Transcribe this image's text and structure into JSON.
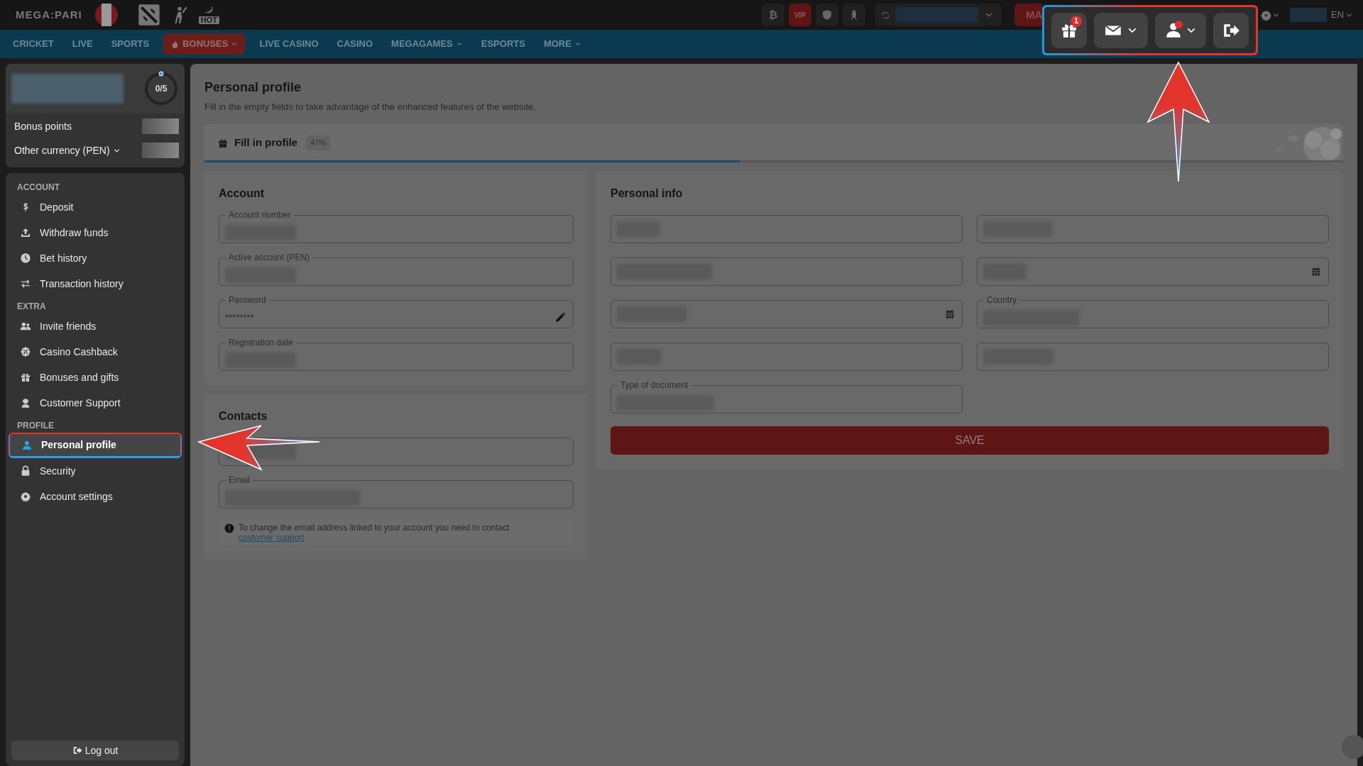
{
  "top_bar": {
    "logo": "MEGA:PARI",
    "hot_label": "HOT",
    "crypto_symbol": "₿",
    "vip_label": "VIP",
    "deposit_button": "MA",
    "gift_count": "1",
    "profile_notification": true,
    "language": "EN"
  },
  "nav": [
    {
      "label": "CRICKET",
      "selected": false,
      "dropdown": false
    },
    {
      "label": "LIVE",
      "selected": false,
      "dropdown": false
    },
    {
      "label": "SPORTS",
      "selected": false,
      "dropdown": false
    },
    {
      "label": "BONUSES",
      "selected": true,
      "dropdown": true
    },
    {
      "label": "LIVE CASINO",
      "selected": false,
      "dropdown": false
    },
    {
      "label": "CASINO",
      "selected": false,
      "dropdown": false
    },
    {
      "label": "MEGAGAMES",
      "selected": false,
      "dropdown": true
    },
    {
      "label": "ESPORTS",
      "selected": false,
      "dropdown": false
    },
    {
      "label": "MORE",
      "selected": false,
      "dropdown": true
    }
  ],
  "sidebar": {
    "progress": "0/5",
    "balances": [
      {
        "label": "Bonus points",
        "dropdown": false
      },
      {
        "label": "Other currency (PEN)",
        "dropdown": true
      }
    ],
    "sections": [
      {
        "title": "ACCOUNT",
        "items": [
          {
            "label": "Deposit",
            "selected": false
          },
          {
            "label": "Withdraw funds",
            "selected": false
          },
          {
            "label": "Bet history",
            "selected": false
          },
          {
            "label": "Transaction history",
            "selected": false
          }
        ]
      },
      {
        "title": "EXTRA",
        "items": [
          {
            "label": "Invite friends",
            "selected": false
          },
          {
            "label": "Casino Cashback",
            "selected": false
          },
          {
            "label": "Bonuses and gifts",
            "selected": false
          },
          {
            "label": "Customer Support",
            "selected": false
          }
        ]
      },
      {
        "title": "PROFILE",
        "items": [
          {
            "label": "Personal profile",
            "selected": true
          },
          {
            "label": "Security",
            "selected": false
          },
          {
            "label": "Account settings",
            "selected": false
          }
        ]
      }
    ],
    "logout": "Log out"
  },
  "page": {
    "title": "Personal profile",
    "subtitle": "Fill in the empty fields to take advantage of the enhanced features of the website.",
    "progress": {
      "label": "Fill in profile",
      "percent": "47%",
      "level": 0.47
    },
    "cards": [
      {
        "title": "Account",
        "fields": [
          {
            "label": "Account number",
            "kind": "redacted"
          },
          {
            "label": "Active account (PEN)",
            "kind": "redacted"
          },
          {
            "label": "Password",
            "value": "********",
            "kind": "editable"
          },
          {
            "label": "Registration date",
            "kind": "redacted"
          }
        ]
      },
      {
        "title": "Contacts",
        "fields": [
          {
            "kind": "redacted"
          },
          {
            "label": "Email",
            "kind": "redacted"
          }
        ],
        "note": "To change the email address linked to your account you need to contact ",
        "note_link": "customer support"
      }
    ],
    "personal_info": {
      "title": "Personal info",
      "fields": [
        {
          "kind": "redacted"
        },
        {
          "kind": "redacted"
        },
        {
          "kind": "redacted"
        },
        {
          "kind": "date"
        },
        {
          "kind": "date"
        },
        {
          "label": "Country",
          "kind": "redacted"
        },
        {
          "kind": "redacted"
        },
        {
          "kind": "redacted"
        },
        {
          "label": "Type of document",
          "kind": "redacted"
        }
      ],
      "save": "SAVE"
    }
  }
}
